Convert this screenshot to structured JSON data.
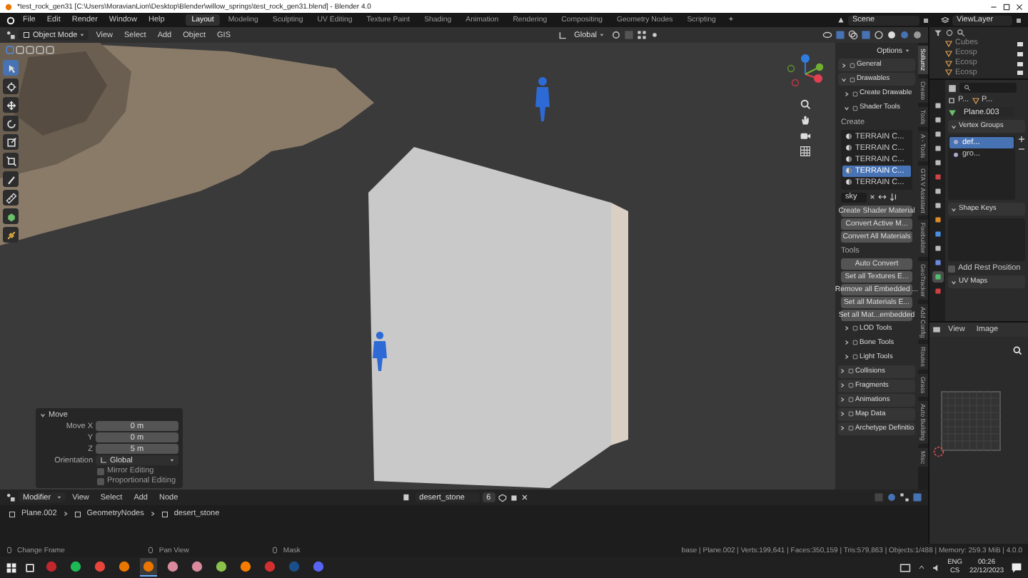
{
  "title_bar": {
    "title": "*test_rock_gen31 [C:\\Users\\MoravianLion\\Desktop\\Blender\\willow_springs\\test_rock_gen31.blend] - Blender 4.0"
  },
  "top_bar": {
    "menus": [
      "File",
      "Edit",
      "Render",
      "Window",
      "Help"
    ],
    "workspaces": [
      {
        "label": "Layout",
        "selected": true
      },
      {
        "label": "Modeling",
        "selected": false
      },
      {
        "label": "Sculpting",
        "selected": false
      },
      {
        "label": "UV Editing",
        "selected": false
      },
      {
        "label": "Texture Paint",
        "selected": false
      },
      {
        "label": "Shading",
        "selected": false
      },
      {
        "label": "Animation",
        "selected": false
      },
      {
        "label": "Rendering",
        "selected": false
      },
      {
        "label": "Compositing",
        "selected": false
      },
      {
        "label": "Geometry Nodes",
        "selected": false
      },
      {
        "label": "Scripting",
        "selected": false
      }
    ],
    "add_tab": "+",
    "scene": "Scene",
    "view_layer": "ViewLayer"
  },
  "viewport_header": {
    "mode": "Object Mode",
    "menus": [
      "View",
      "Select",
      "Add",
      "Object",
      "GIS"
    ],
    "orientation": "Global"
  },
  "toolbar": {
    "tools": [
      {
        "selected": true
      },
      {
        "selected": false
      },
      {
        "selected": false
      },
      {
        "selected": false
      },
      {
        "selected": false
      },
      {
        "selected": false
      },
      {
        "selected": false
      },
      {
        "selected": false
      },
      {
        "selected": false
      },
      {
        "selected": false
      }
    ]
  },
  "operator_panel": {
    "title": "Move",
    "expanded": true,
    "fields": [
      {
        "label": "Move X",
        "value": "0 m"
      },
      {
        "label": "Y",
        "value": "0 m"
      },
      {
        "label": "Z",
        "value": "5 m"
      }
    ],
    "orientation_label": "Orientation",
    "orientation": "Global",
    "options": [
      {
        "label": "Mirror Editing",
        "checked": false
      },
      {
        "label": "Proportional Editing",
        "checked": false
      }
    ]
  },
  "sidebar": {
    "options": "Options",
    "panels": [
      {
        "label": "General",
        "expanded": false
      },
      {
        "label": "Drawables",
        "expanded": true
      }
    ],
    "subpanels": [
      {
        "label": "Create Drawable",
        "expanded": false
      },
      {
        "label": "Shader Tools",
        "expanded": true
      }
    ],
    "create_heading": "Create",
    "shader_list": [
      {
        "label": "TERRAIN C...",
        "selected": false
      },
      {
        "label": "TERRAIN C...",
        "selected": false
      },
      {
        "label": "TERRAIN C...",
        "selected": false
      },
      {
        "label": "TERRAIN C...",
        "selected": true
      },
      {
        "label": "TERRAIN C...",
        "selected": false
      }
    ],
    "filter": "sky",
    "create_buttons": [
      "Create Shader Material",
      "Convert Active M...",
      "Convert All Materials"
    ],
    "tools_heading": "Tools",
    "tool_buttons": [
      "Auto Convert",
      "Set all Textures E...",
      "Remove all Embedded ...",
      "Set all Materials E...",
      "Set all Mat...embedded"
    ],
    "tool_subpanels": [
      {
        "label": "LOD Tools",
        "expanded": false
      },
      {
        "label": "Bone Tools",
        "expanded": false
      },
      {
        "label": "Light Tools",
        "expanded": false
      }
    ],
    "more_panels": [
      {
        "label": "Collisions",
        "expanded": false
      },
      {
        "label": "Fragments",
        "expanded": false
      },
      {
        "label": "Animations",
        "expanded": false
      },
      {
        "label": "Map Data",
        "expanded": false
      },
      {
        "label": "Archetype Definitio",
        "expanded": false
      }
    ],
    "tabs": [
      {
        "label": "Sollumz",
        "selected": true
      },
      {
        "label": "Create",
        "selected": false
      },
      {
        "label": "Tools",
        "selected": false
      },
      {
        "label": "A - Tools",
        "selected": false
      },
      {
        "label": "GTA V Assistant",
        "selected": false
      },
      {
        "label": "Fixebuilder",
        "selected": false
      },
      {
        "label": "GeoTracker",
        "selected": false
      },
      {
        "label": "Add Config",
        "selected": false
      },
      {
        "label": "Routes",
        "selected": false
      },
      {
        "label": "Grass",
        "selected": false
      },
      {
        "label": "Auto Building",
        "selected": false
      },
      {
        "label": "Misc",
        "selected": false
      }
    ]
  },
  "outliner": {
    "rows": [
      {
        "name": "Cubes"
      },
      {
        "name": "Ecosp"
      },
      {
        "name": "Ecosp"
      },
      {
        "name": "Ecosp"
      }
    ]
  },
  "properties": {
    "tabs": [
      {
        "selected": false
      },
      {
        "selected": false
      },
      {
        "selected": false
      },
      {
        "selected": false
      },
      {
        "selected": false
      },
      {
        "selected": false
      },
      {
        "selected": false
      },
      {
        "selected": false
      },
      {
        "selected": false
      },
      {
        "selected": false
      },
      {
        "selected": false
      },
      {
        "selected": false
      },
      {
        "selected": true
      },
      {
        "selected": false
      }
    ],
    "breadcrumb": [
      "P...",
      "P..."
    ],
    "object_name": "Plane.003",
    "vertex_groups": {
      "label": "Vertex Groups",
      "expanded": true,
      "items": [
        {
          "name": "def...",
          "selected": true
        },
        {
          "name": "gro...",
          "selected": false
        }
      ]
    },
    "shape_keys": {
      "label": "Shape Keys",
      "expanded": true
    },
    "add_rest_position": {
      "label": "Add Rest Position",
      "checked": false
    },
    "uv_maps": {
      "label": "UV Maps",
      "expanded": true
    }
  },
  "image_editor": {
    "menus": [
      "View",
      "Image"
    ]
  },
  "node_editor": {
    "editor_type": "Modifier",
    "menus": [
      "View",
      "Select",
      "Add",
      "Node"
    ],
    "node_group": "desert_stone",
    "users": "6",
    "breadcrumb": [
      "Plane.002",
      "GeometryNodes",
      "desert_stone"
    ]
  },
  "status_bar": {
    "hints": [
      "Change Frame",
      "Pan View",
      "Mask"
    ],
    "stats": "base | Plane.002 | Verts:199,641 | Faces:350,159 | Tris:579,863 | Objects:1/488 | Memory: 259.3 MiB | 4.0.0"
  },
  "taskbar": {
    "apps": [
      {
        "color": "#c0282d",
        "active": false
      },
      {
        "color": "#1db954",
        "active": false
      },
      {
        "color": "#e8453c",
        "active": false
      },
      {
        "color": "#ea7600",
        "active": false
      },
      {
        "color": "#ea7600",
        "active": true
      },
      {
        "color": "#d98a9c",
        "active": false
      },
      {
        "color": "#d98a9c",
        "active": false
      },
      {
        "color": "#8bc34a",
        "active": false
      },
      {
        "color": "#f57c00",
        "active": false
      },
      {
        "color": "#d32f2f",
        "active": false
      },
      {
        "color": "#1b4f8a",
        "active": false
      },
      {
        "color": "#5865f2",
        "active": false
      }
    ],
    "language": "ENG",
    "layout": "CS",
    "time": "00:26",
    "date": "22/12/2023"
  }
}
